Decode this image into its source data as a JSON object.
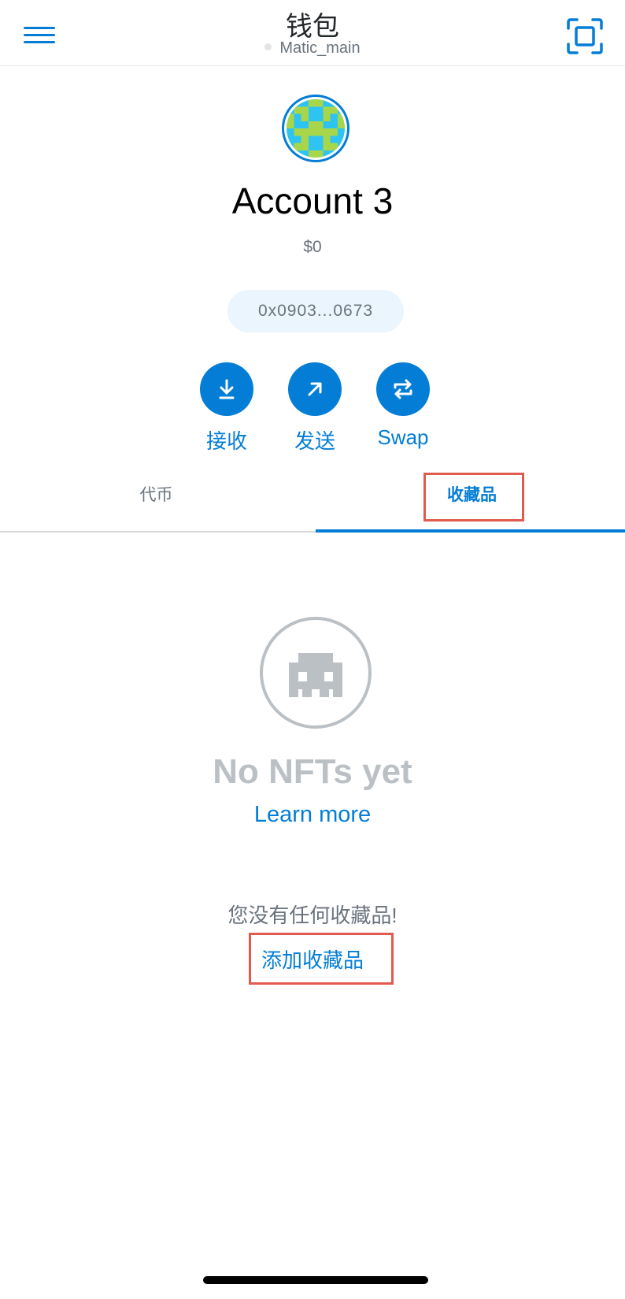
{
  "header": {
    "title": "钱包",
    "network": "Matic_main",
    "menu_icon": "hamburger-menu-icon",
    "scan_icon": "qr-scan-icon"
  },
  "account": {
    "name": "Account 3",
    "balance": "$0",
    "address": "0x0903...0673",
    "avatar_icon": "identicon-avatar"
  },
  "actions": [
    {
      "label": "接收",
      "icon": "receive-arrow-down-icon"
    },
    {
      "label": "发送",
      "icon": "send-arrow-up-right-icon"
    },
    {
      "label": "Swap",
      "icon": "swap-arrows-icon"
    }
  ],
  "tabs": [
    {
      "label": "代币",
      "active": false
    },
    {
      "label": "收藏品",
      "active": true
    }
  ],
  "collectibles": {
    "empty_icon": "space-invader-nft-icon",
    "empty_title": "No NFTs yet",
    "learn_more": "Learn more",
    "no_collectibles_text": "您没有任何收藏品!",
    "add_collectibles": "添加收藏品"
  },
  "colors": {
    "accent": "#037dd6",
    "muted_text": "#6a737d",
    "empty_gray": "#bbc0c5",
    "highlight_red": "#e05a4e",
    "address_bg": "#eaf5fd"
  }
}
